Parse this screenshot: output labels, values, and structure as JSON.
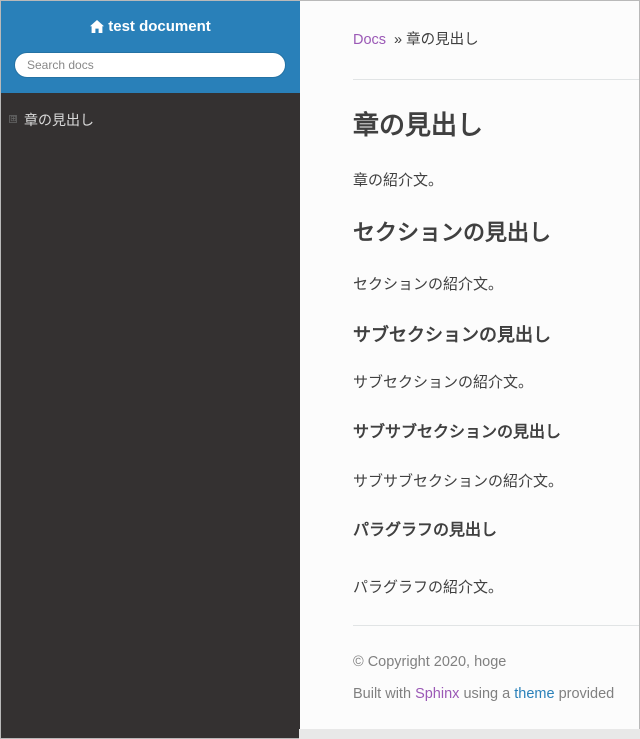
{
  "sidebar": {
    "brand": "test document",
    "search_placeholder": "Search docs",
    "toc": [
      {
        "label": "章の見出し",
        "expand": "⊞"
      }
    ]
  },
  "breadcrumb": {
    "home": "Docs",
    "separator": "»",
    "current": "章の見出し"
  },
  "main": {
    "h1": "章の見出し",
    "p1": "章の紹介文。",
    "h2": "セクションの見出し",
    "p2": "セクションの紹介文。",
    "h3": "サブセクションの見出し",
    "p3": "サブセクションの紹介文。",
    "h4": "サブサブセクションの見出し",
    "p4": "サブサブセクションの紹介文。",
    "h5": "パラグラフの見出し",
    "p5": "パラグラフの紹介文。"
  },
  "footer": {
    "copyright": "© Copyright 2020, hoge",
    "built_with": "Built with",
    "sphinx": "Sphinx",
    "using_a": "using a",
    "theme": "theme",
    "provided": "provided"
  }
}
